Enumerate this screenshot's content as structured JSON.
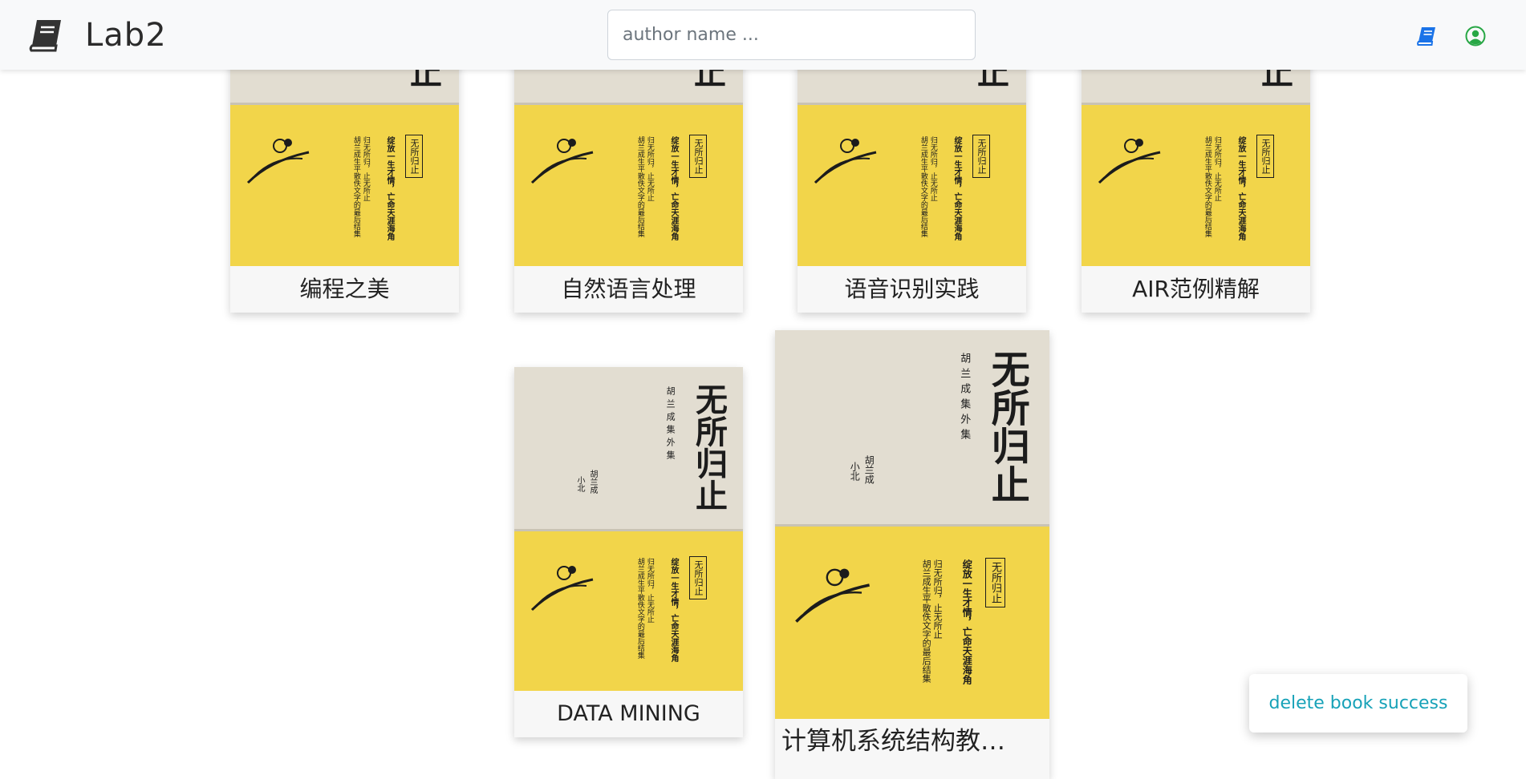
{
  "header": {
    "brand": "Lab2",
    "search_placeholder": "author name ..."
  },
  "icons": {
    "brand": "book-icon",
    "books_nav": "book-icon",
    "user_nav": "user-circle-icon"
  },
  "colors": {
    "navbar_bg": "#f8f9fa",
    "book_nav": "#1a73e8",
    "user_nav": "#28a745",
    "toast_text": "#17a2b8",
    "cover_top": "#e2ddd1",
    "cover_bottom": "#f2d54a"
  },
  "books": [
    {
      "title": "编程之美"
    },
    {
      "title": "自然语言处理"
    },
    {
      "title": "语音识别实践"
    },
    {
      "title": "AIR范例精解"
    },
    {
      "title": "DATA MINING"
    },
    {
      "title": "计算机系统结构教…"
    }
  ],
  "cover": {
    "frame_text": "无所归止",
    "slogan_1": "绽放一生才情，亡命天涯海角",
    "slogan_2": "归无所归，止无所止",
    "slogan_3": "胡兰成生平散佚文字的最后结集",
    "calligraphy": "无所归止",
    "series": "胡兰成集外集",
    "author": "胡兰成",
    "editor": "小北"
  },
  "toast": {
    "message": "delete book success"
  }
}
